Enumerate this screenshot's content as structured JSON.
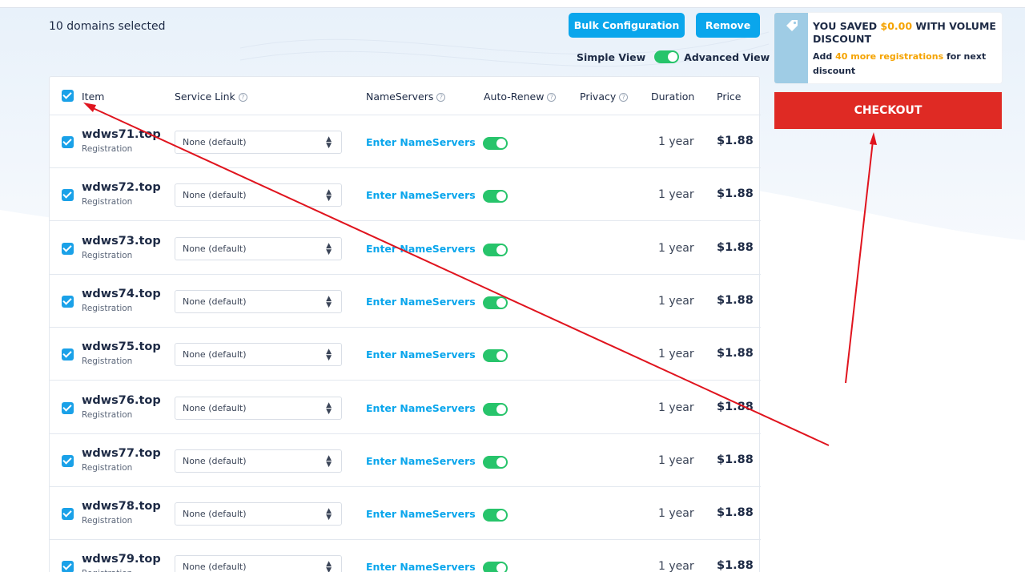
{
  "header": {
    "domains_selected": "10 domains selected",
    "bulk_button": "Bulk Configuration",
    "remove_button": "Remove",
    "simple_view": "Simple View",
    "advanced_view": "Advanced View"
  },
  "table": {
    "columns": {
      "item": "Item",
      "service_link": "Service Link",
      "nameservers": "NameServers",
      "auto_renew": "Auto-Renew",
      "privacy": "Privacy",
      "duration": "Duration",
      "price": "Price"
    },
    "rows": [
      {
        "domain": "wdws71.top",
        "type": "Registration",
        "service": "None (default)",
        "ns": "Enter NameServers",
        "duration": "1 year",
        "price": "$1.88"
      },
      {
        "domain": "wdws72.top",
        "type": "Registration",
        "service": "None (default)",
        "ns": "Enter NameServers",
        "duration": "1 year",
        "price": "$1.88"
      },
      {
        "domain": "wdws73.top",
        "type": "Registration",
        "service": "None (default)",
        "ns": "Enter NameServers",
        "duration": "1 year",
        "price": "$1.88"
      },
      {
        "domain": "wdws74.top",
        "type": "Registration",
        "service": "None (default)",
        "ns": "Enter NameServers",
        "duration": "1 year",
        "price": "$1.88"
      },
      {
        "domain": "wdws75.top",
        "type": "Registration",
        "service": "None (default)",
        "ns": "Enter NameServers",
        "duration": "1 year",
        "price": "$1.88"
      },
      {
        "domain": "wdws76.top",
        "type": "Registration",
        "service": "None (default)",
        "ns": "Enter NameServers",
        "duration": "1 year",
        "price": "$1.88"
      },
      {
        "domain": "wdws77.top",
        "type": "Registration",
        "service": "None (default)",
        "ns": "Enter NameServers",
        "duration": "1 year",
        "price": "$1.88"
      },
      {
        "domain": "wdws78.top",
        "type": "Registration",
        "service": "None (default)",
        "ns": "Enter NameServers",
        "duration": "1 year",
        "price": "$1.88"
      },
      {
        "domain": "wdws79.top",
        "type": "Registration",
        "service": "None (default)",
        "ns": "Enter NameServers",
        "duration": "1 year",
        "price": "$1.88"
      }
    ]
  },
  "promo": {
    "title_pre": "YOU SAVED ",
    "title_amount": "$0.00",
    "title_post": " WITH VOLUME DISCOUNT",
    "sub_pre": "Add ",
    "sub_highlight": "40 more registrations",
    "sub_post": " for next discount"
  },
  "checkout_label": "CHECKOUT",
  "colors": {
    "accent_blue": "#0aa6ec",
    "toggle_green": "#27c46b",
    "checkout_red": "#df2a24",
    "highlight_orange": "#f5a300",
    "annotation_arrow": "#e0141e"
  },
  "icons": [
    "help-icon",
    "checkbox-icon",
    "toggle-switch",
    "select-arrow-icon",
    "price-tag-icon"
  ]
}
